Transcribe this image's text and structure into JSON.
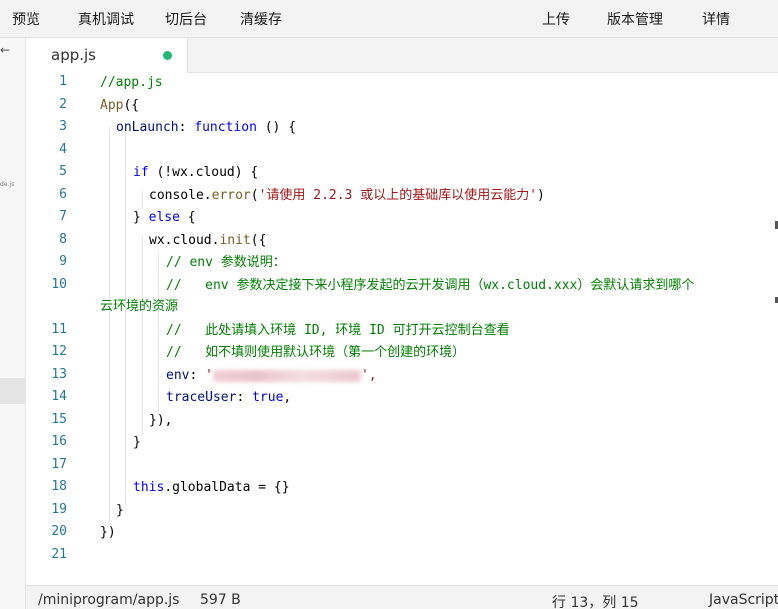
{
  "toolbar": {
    "preview": "预览",
    "remote_debug": "真机调试",
    "background": "切后台",
    "clear_cache": "清缓存",
    "upload": "上传",
    "version_mgmt": "版本管理",
    "details": "详情"
  },
  "sidebar": {
    "back_icon": "←",
    "file_icon_text": "de.js"
  },
  "tab": {
    "filename": "app.js",
    "modified_color": "#1fb877"
  },
  "editor": {
    "line_numbers": [
      "1",
      "2",
      "3",
      "4",
      "5",
      "6",
      "7",
      "8",
      "9",
      "10",
      "11",
      "12",
      "13",
      "14",
      "15",
      "16",
      "17",
      "18",
      "19",
      "20",
      "21"
    ],
    "code": {
      "l1": "//app.js",
      "l2_a": "App",
      "l2_b": "({",
      "l3_a": "onLaunch",
      "l3_b": ": ",
      "l3_c": "function",
      "l3_d": " () {",
      "l5_a": "if",
      "l5_b": " (!wx.cloud) {",
      "l6_a": "console.",
      "l6_b": "error",
      "l6_c": "(",
      "l6_d": "'请使用 2.2.3 或以上的基础库以使用云能力'",
      "l6_e": ")",
      "l7_a": "} ",
      "l7_b": "else",
      "l7_c": " {",
      "l8_a": "wx.cloud.",
      "l8_b": "init",
      "l8_c": "({",
      "l9": "// env 参数说明：",
      "l10": "//   env 参数决定接下来小程序发起的云开发调用（wx.cloud.xxx）会默认请求到哪个",
      "l10_wrap": "云环境的资源",
      "l11": "//   此处请填入环境 ID, 环境 ID 可打开云控制台查看",
      "l12": "//   如不填则使用默认环境（第一个创建的环境）",
      "l13_a": "env",
      "l13_b": ": ",
      "l13_c": "'",
      "l13_d": "',",
      "l14_a": "traceUser",
      "l14_b": ": ",
      "l14_c": "true",
      "l14_d": ",",
      "l15": "}),",
      "l16": "}",
      "l18_a": "this",
      "l18_b": ".globalData = {}",
      "l19": "}",
      "l20": "})"
    }
  },
  "statusbar": {
    "path": "/miniprogram/app.js",
    "size": "597 B",
    "cursor": "行 13，列 15",
    "language": "JavaScript"
  }
}
